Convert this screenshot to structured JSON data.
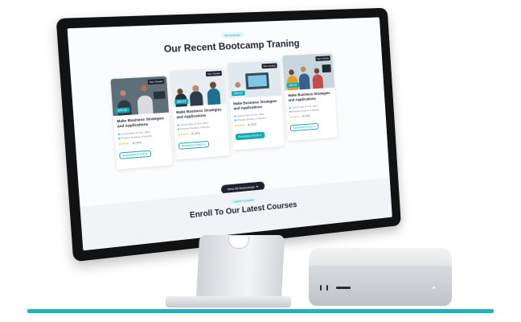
{
  "section_tag": "Bootcamps",
  "title": "Our Recent Bootcamp Traning",
  "cards": [
    {
      "badge": "Sent Details",
      "price": "$99.00",
      "title": "Make Business Strategies and Applications",
      "meta_launch": "Launch date 27 Feb, 2023",
      "meta_duration": "Program Duration 4 Months",
      "stars": "★★★★☆",
      "rating": "4",
      "count": "(365)",
      "cta": "Bootcamp Enroll ➔",
      "cta_filled": false
    },
    {
      "badge": "Sent Details",
      "price": "$99.00",
      "title": "Make Business Strategies and Applications",
      "meta_launch": "Launch date 27 Feb, 2023",
      "meta_duration": "Program Duration 4 Months",
      "stars": "★★★★☆",
      "rating": "4",
      "count": "(365)",
      "cta": "Bootcamp Enroll ➔",
      "cta_filled": false
    },
    {
      "badge": "Sent Details",
      "price": "$99.00",
      "title": "Make Business Strategies and Applications",
      "meta_launch": "Launch date 27 Feb, 2023",
      "meta_duration": "Program Duration 4 Months",
      "stars": "★★★★☆",
      "rating": "4",
      "count": "(365)",
      "cta": "Bootcamp Enroll ➔",
      "cta_filled": true
    },
    {
      "badge": "Sent Details",
      "price": "$99.00",
      "title": "Make Business Strategies and Applications",
      "meta_launch": "Launch date 27 Feb, 2023",
      "meta_duration": "Program Duration 4 Months",
      "stars": "★★★★☆",
      "rating": "4",
      "count": "(365)",
      "cta": "Bootcamp Enroll ➔",
      "cta_filled": false
    }
  ],
  "view_all": "View All Bootcamps ➔",
  "lower": {
    "tag": "Latest Courses",
    "title": "Enroll To Our Latest Courses"
  },
  "colors": {
    "accent": "#14a9b5",
    "dark": "#1f2130",
    "floor_line": "#1fb3be"
  }
}
